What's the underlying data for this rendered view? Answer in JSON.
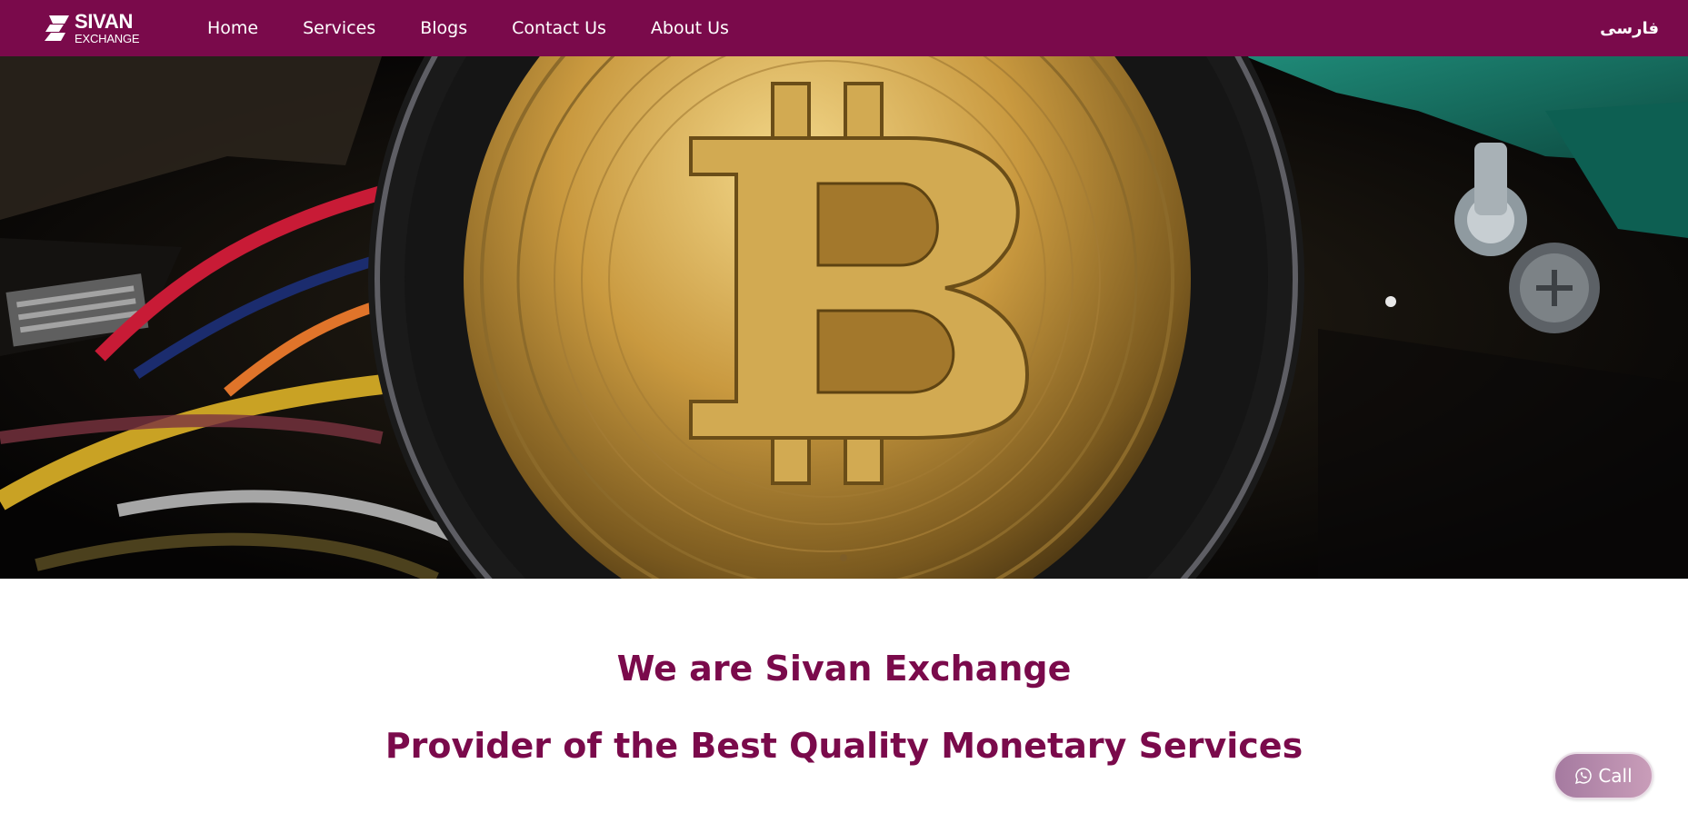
{
  "brand": {
    "name": "SIVAN",
    "subtitle": "EXCHANGE",
    "color": "#7a0a4b"
  },
  "nav": {
    "items": [
      {
        "label": "Home"
      },
      {
        "label": "Services"
      },
      {
        "label": "Blogs"
      },
      {
        "label": "Contact Us"
      },
      {
        "label": "About Us"
      }
    ],
    "language": "فارسی"
  },
  "hero": {
    "image": "bitcoin-coin-photo",
    "slide_count": 1,
    "active_slide": 1
  },
  "content": {
    "headline": "We are Sivan Exchange",
    "subheadline": "Provider of the Best Quality Monetary Services"
  },
  "call_button": {
    "label": "Call",
    "icon": "whatsapp-icon"
  }
}
